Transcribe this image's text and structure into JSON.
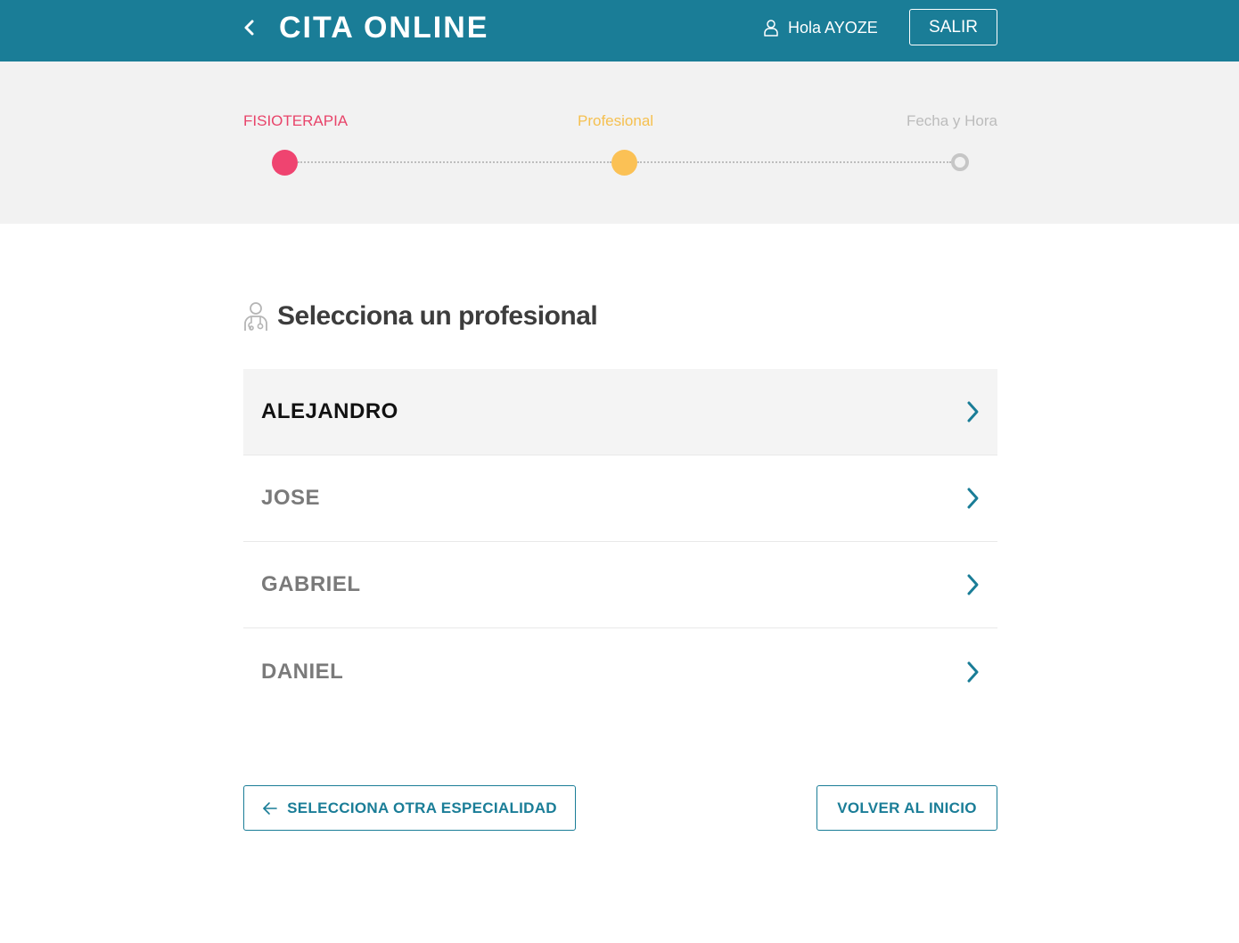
{
  "header": {
    "title": "CITA ONLINE",
    "greeting": "Hola AYOZE",
    "logout_label": "SALIR"
  },
  "stepper": {
    "steps": [
      {
        "label": "FISIOTERAPIA",
        "state": "done",
        "color": "#ef4470"
      },
      {
        "label": "Profesional",
        "state": "current",
        "color": "#fbc155"
      },
      {
        "label": "Fecha y Hora",
        "state": "pending",
        "color": "#c6c6c6"
      }
    ]
  },
  "main": {
    "section_title": "Selecciona un profesional",
    "professionals": [
      {
        "name": "ALEJANDRO",
        "active": true
      },
      {
        "name": "JOSE",
        "active": false
      },
      {
        "name": "GABRIEL",
        "active": false
      },
      {
        "name": "DANIEL",
        "active": false
      }
    ]
  },
  "footer": {
    "back_specialty_label": "SELECCIONA OTRA ESPECIALIDAD",
    "home_label": "VOLVER AL INICIO"
  },
  "colors": {
    "primary": "#1a7d97",
    "step_done": "#ef4470",
    "step_current": "#fbc155"
  },
  "icons": [
    "chevron-left-icon",
    "user-icon",
    "doctor-icon",
    "chevron-right-icon",
    "arrow-left-icon"
  ]
}
